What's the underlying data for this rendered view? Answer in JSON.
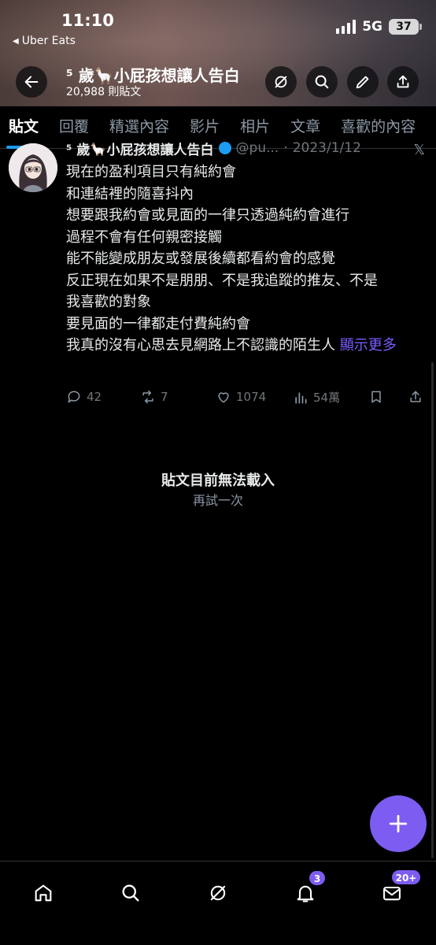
{
  "status_bar": {
    "time": "11:10",
    "back_app_label": "Uber Eats",
    "network": "5G",
    "battery": "37"
  },
  "header": {
    "title": "⁵ 歲🦙小屁孩想讓人告白",
    "subtitle": "20,988 則貼文"
  },
  "tabs": [
    "貼文",
    "回覆",
    "精選內容",
    "影片",
    "相片",
    "文章",
    "喜歡的內容"
  ],
  "post": {
    "author_name": "⁵ 歲🦙小屁孩想讓人告白",
    "handle": "@pu...",
    "date": "2023/1/12",
    "lines": [
      "現在的盈利項目只有純約會",
      "和連結裡的隨喜抖內",
      "想要跟我約會或見面的一律只透過純約會進行",
      "過程不會有任何親密接觸",
      "能不能變成朋友或發展後續都看約會的感覺",
      "反正現在如果不是朋朋、不是我追蹤的推友、不是",
      "我喜歡的對象",
      "要見面的一律都走付費純約會",
      "我真的沒有心思去見網路上不認識的陌生人"
    ],
    "show_more": "顯示更多",
    "stats": {
      "replies": "42",
      "retweets": "7",
      "likes": "1074",
      "views": "54萬"
    }
  },
  "empty_state": {
    "title": "貼文目前無法載入",
    "retry": "再試一次"
  },
  "bottom_nav": {
    "notifications_badge": "3",
    "messages_badge": "20+"
  },
  "colors": {
    "accent": "#7d5cf2",
    "link": "#7c5cff",
    "muted": "#71767b",
    "tab_indicator": "#1d9bf0"
  },
  "icons": [
    "back-arrow-icon",
    "grok-icon",
    "search-icon",
    "edit-icon",
    "share-icon",
    "reply-icon",
    "retweet-icon",
    "like-icon",
    "views-icon",
    "bookmark-icon",
    "home-icon",
    "bell-icon",
    "mail-icon",
    "plus-icon"
  ]
}
